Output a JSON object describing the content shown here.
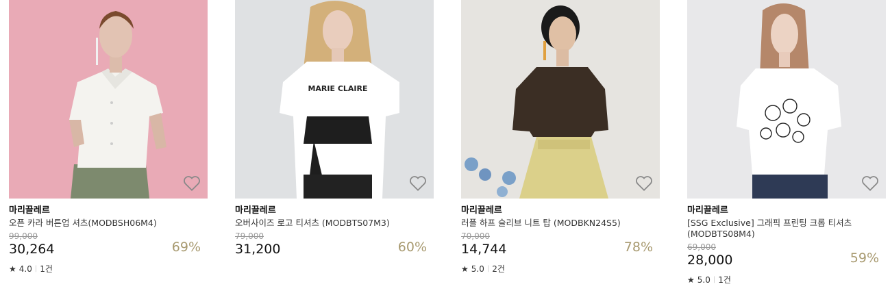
{
  "products": [
    {
      "brand": "마리끌레르",
      "name": "오픈 카라 버튼업 셔츠(MODBSH06M4)",
      "original_price": "99,000",
      "price": "30,264",
      "discount": "69%",
      "rating": "4.0",
      "reviews": "1건",
      "photo_bg": "#e9aab6"
    },
    {
      "brand": "마리끌레르",
      "name": "오버사이즈 로고 티셔츠 (MODBTS07M3)",
      "original_price": "79,000",
      "price": "31,200",
      "discount": "60%",
      "photo_bg": "#dfe1e3",
      "print_text": "MARIE CLAIRE"
    },
    {
      "brand": "마리끌레르",
      "name": "러플 하프 슬리브 니트 탑 (MODBKN24S5)",
      "original_price": "70,000",
      "price": "14,744",
      "discount": "78%",
      "rating": "5.0",
      "reviews": "2건",
      "photo_bg": "#e6e4e0"
    },
    {
      "brand": "마리끌레르",
      "name": "[SSG Exclusive] 그래픽 프린팅 크롭 티셔츠 (MODBTS08M4)",
      "original_price": "69,000",
      "price": "28,000",
      "discount": "59%",
      "rating": "5.0",
      "reviews": "1건",
      "photo_bg": "#e8e8ea"
    }
  ],
  "icons": {
    "wishlist": "heart-outline-icon",
    "rating": "star-icon"
  },
  "colors": {
    "discount": "#a89a70",
    "original_price": "#999999"
  }
}
